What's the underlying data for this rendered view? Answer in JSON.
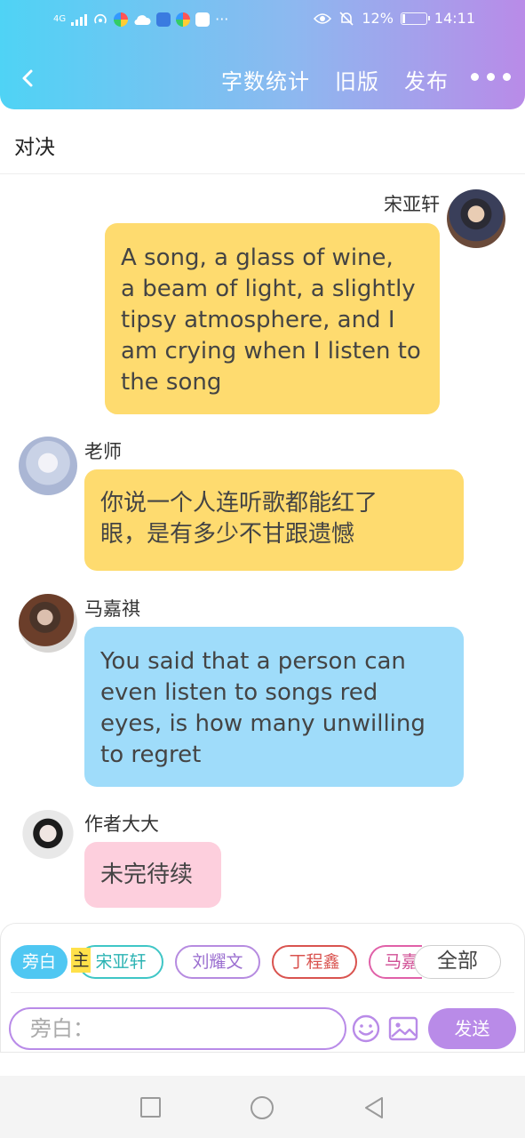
{
  "status_bar": {
    "network": "4G",
    "battery": "12%",
    "battery_level": 0.12,
    "time": "14:11",
    "more": "···"
  },
  "navbar": {
    "word_count": "字数统计",
    "old_version": "旧版",
    "publish": "发布"
  },
  "title": "对决",
  "messages": [
    {
      "name": "宋亚轩",
      "side": "right",
      "lines": [
        "A song, a glass of wine,",
        "a beam of light, a slightly",
        "tipsy atmosphere, and I",
        "am crying when I listen to",
        "the song"
      ],
      "color": "#fedb6f"
    },
    {
      "name": "老师",
      "side": "left",
      "lines": [
        "你说一个人连听歌都能红了",
        "眼，是有多少不甘跟遗憾"
      ],
      "color": "#fedb6f"
    },
    {
      "name": "马嘉祺",
      "side": "left",
      "lines": [
        "You said that a person can",
        "even listen to songs red",
        "eyes, is how many unwilling",
        "to regret"
      ],
      "color": "#9fdcfa"
    },
    {
      "name": "作者大大",
      "side": "left",
      "lines": [
        "未完待续"
      ],
      "color": "#fdcfdd"
    }
  ],
  "role_chips": {
    "narrator": "旁白",
    "main_tag": "主",
    "song": "宋亚轩",
    "liu": "刘耀文",
    "ding": "丁程鑫",
    "ma": "马嘉",
    "all": "全部"
  },
  "composer": {
    "placeholder": "旁白：",
    "send": "发送"
  },
  "icons": {
    "back": "chevron-left-icon",
    "more": "more-dots-icon",
    "emoji": "smiley-icon",
    "image": "image-icon"
  }
}
